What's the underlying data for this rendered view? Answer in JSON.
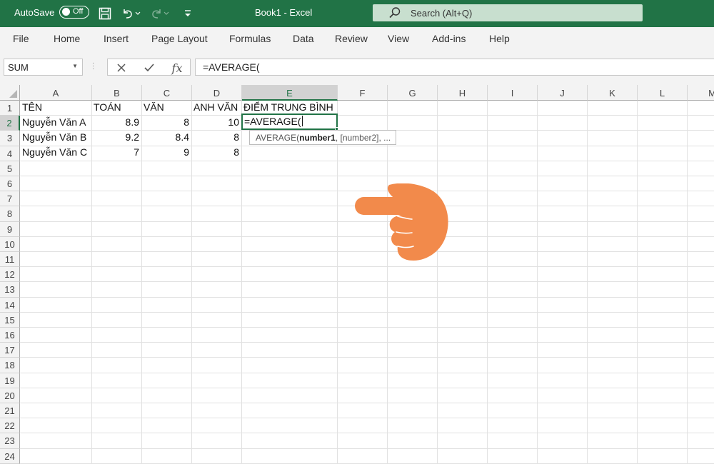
{
  "titlebar": {
    "autosave_label": "AutoSave",
    "autosave_state": "Off",
    "document_title": "Book1  -  Excel",
    "search_placeholder": "Search (Alt+Q)"
  },
  "ribbon_tabs": [
    "File",
    "Home",
    "Insert",
    "Page Layout",
    "Formulas",
    "Data",
    "Review",
    "View",
    "Add-ins",
    "Help"
  ],
  "formula_bar": {
    "name_box": "SUM",
    "formula": "=AVERAGE("
  },
  "columns": [
    "A",
    "B",
    "C",
    "D",
    "E",
    "F",
    "G",
    "H",
    "I",
    "J",
    "K",
    "L",
    "M"
  ],
  "rows": [
    "1",
    "2",
    "3",
    "4",
    "5",
    "6",
    "7",
    "8",
    "9",
    "10",
    "11",
    "12",
    "13",
    "14",
    "15",
    "16",
    "17",
    "18",
    "19",
    "20",
    "21",
    "22",
    "23",
    "24"
  ],
  "sheet": {
    "header": [
      "TÊN",
      "TOÁN",
      "VĂN",
      "ANH VĂN",
      "ĐIỂM TRUNG BÌNH"
    ],
    "data": [
      [
        "Nguyễn Văn A",
        "8.9",
        "8",
        "10"
      ],
      [
        "Nguyễn Văn B",
        "9.2",
        "8.4",
        "8"
      ],
      [
        "Nguyễn Văn C",
        "7",
        "9",
        "8"
      ]
    ],
    "active_cell_text": "=AVERAGE(",
    "active_column": "E",
    "active_row": "2"
  },
  "tooltip": {
    "func": "AVERAGE(",
    "arg1": "number1",
    "rest": ", [number2], ..."
  },
  "colors": {
    "excel_green": "#217346",
    "hand_orange": "#f28a4b"
  }
}
